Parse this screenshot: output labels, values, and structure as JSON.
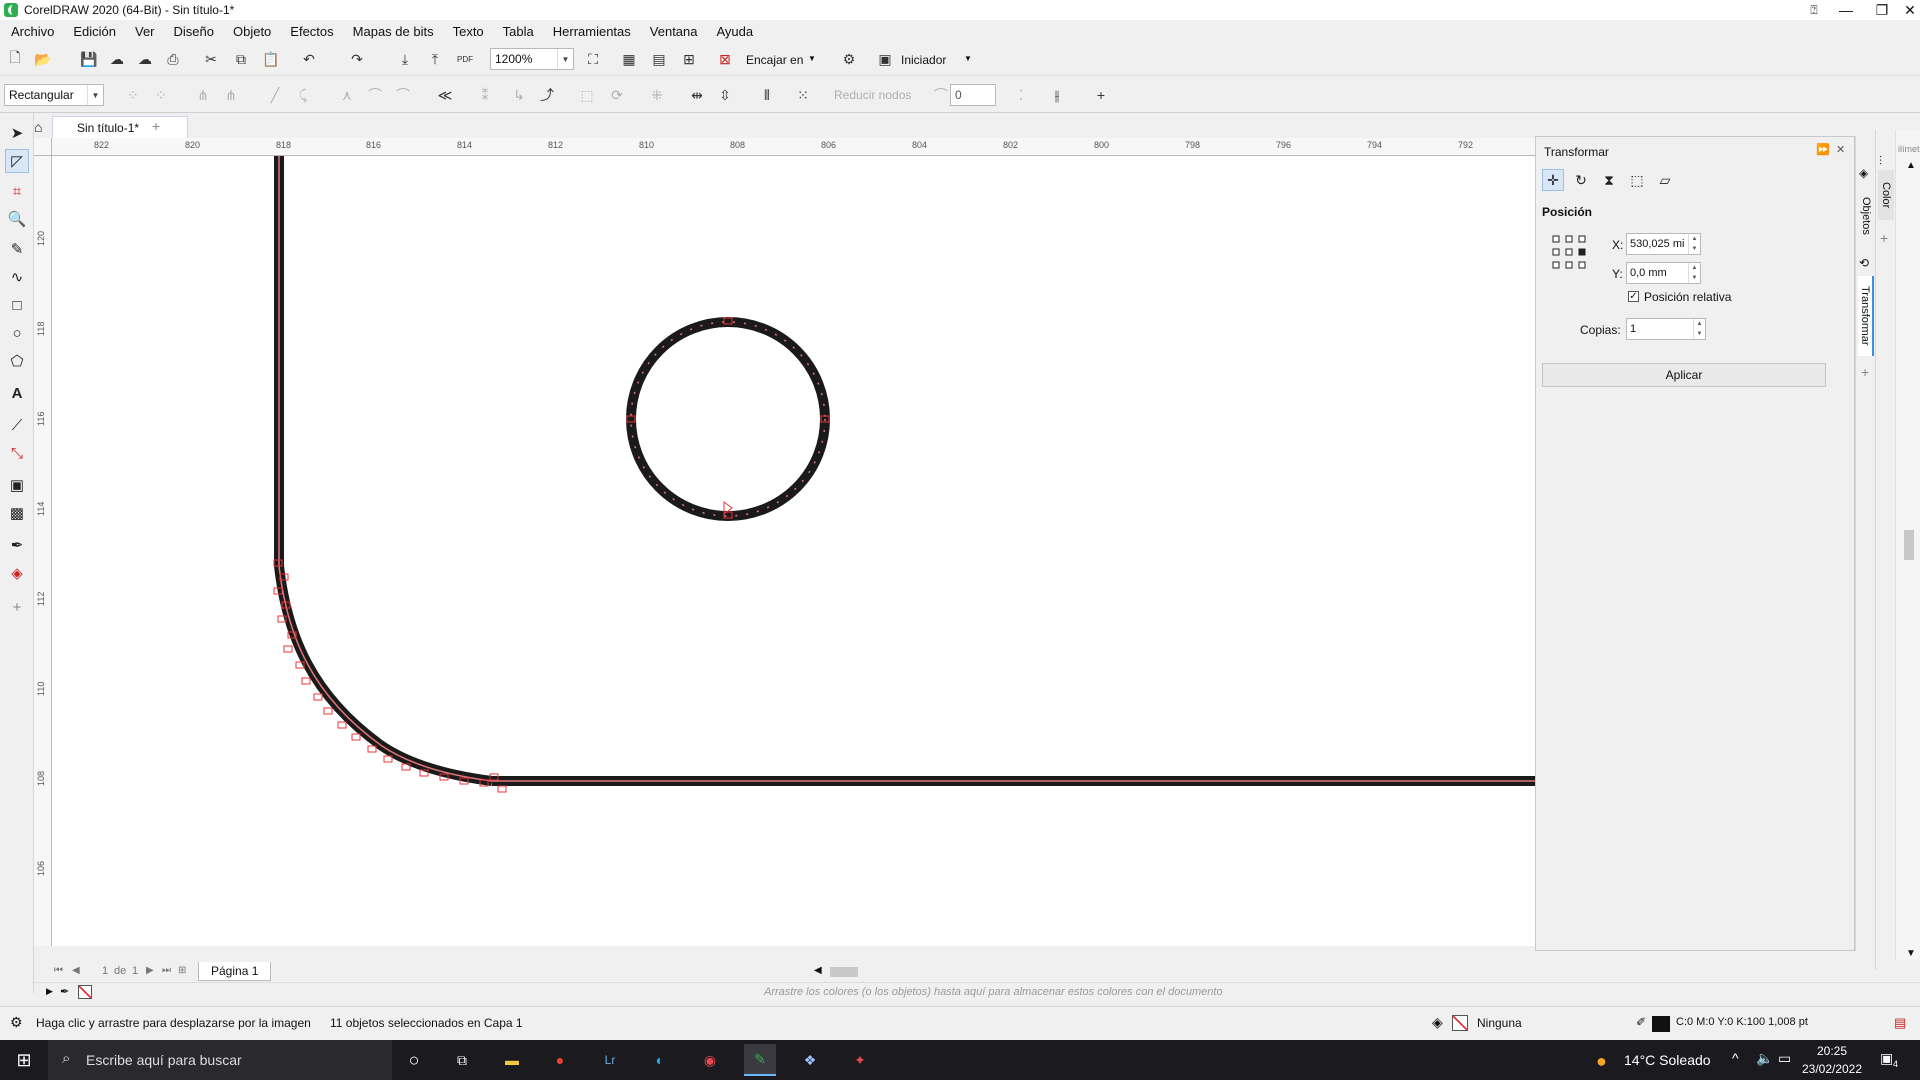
{
  "window": {
    "title": "CorelDRAW 2020 (64-Bit) - Sin título-1*"
  },
  "menu": [
    "Archivo",
    "Edición",
    "Ver",
    "Diseño",
    "Objeto",
    "Efectos",
    "Mapas de bits",
    "Texto",
    "Tabla",
    "Herramientas",
    "Ventana",
    "Ayuda"
  ],
  "toolbar": {
    "zoom": "1200%",
    "snap_label": "Encajar en",
    "launcher_label": "Iniciador",
    "pdf_label": "PDF"
  },
  "property_bar": {
    "selection_mode": "Rectangular",
    "reduce_nodes": "Reducir nodos",
    "curve_value": "0"
  },
  "tab": {
    "doc_name": "Sin título-1*"
  },
  "rulers": {
    "h_ticks": [
      "822",
      "820",
      "818",
      "816",
      "814",
      "812",
      "810",
      "808",
      "806",
      "804",
      "802",
      "800",
      "798",
      "796",
      "794",
      "792"
    ],
    "v_ticks": [
      "120",
      "118",
      "116",
      "114",
      "112",
      "110",
      "108",
      "106"
    ],
    "unit_text": "ilímetros"
  },
  "docker": {
    "title": "Transformar",
    "section": "Posición",
    "x_label": "X:",
    "x_value": "530,025 mi",
    "y_label": "Y:",
    "y_value": "0,0 mm",
    "relative_label": "Posición relativa",
    "copies_label": "Copias:",
    "copies_value": "1",
    "apply_label": "Aplicar",
    "tabs": {
      "objects": "Objetos",
      "transform": "Transformar",
      "color": "Color"
    }
  },
  "pagebar": {
    "page_of": "1",
    "de": "de",
    "total": "1",
    "page_tab": "Página 1"
  },
  "palette_hint": "Arrastre los colores (o los objetos) hasta aquí para almacenar estos colores con el documento",
  "status": {
    "hint": "Haga clic y arrastre para desplazarse por la imagen",
    "selection": "11 objetos seleccionados en Capa 1",
    "fill": "Ninguna",
    "outline": "C:0 M:0 Y:0 K:100  1,008 pt"
  },
  "taskbar": {
    "search_placeholder": "Escribe aquí para buscar",
    "weather": "14°C  Soleado",
    "time": "20:25",
    "date": "23/02/2022",
    "notifications": "4"
  },
  "colors": {
    "accent": "#2eae4f",
    "selection": "#e8343a",
    "taskbar": "#1b1b1f"
  }
}
